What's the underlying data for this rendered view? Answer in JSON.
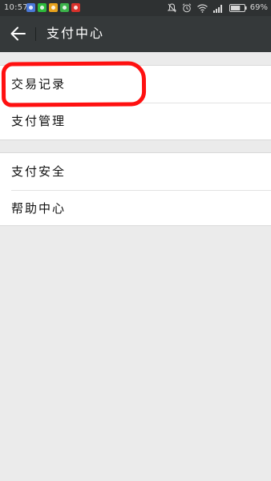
{
  "status_bar": {
    "time": "10:57",
    "battery": "69%",
    "notification_icons": [
      "app-notification-icon",
      "wechat-icon",
      "weibo-icon",
      "wechat-icon",
      "netease-music-icon"
    ]
  },
  "app_bar": {
    "title": "支付中心"
  },
  "sections": [
    {
      "items": [
        {
          "label": "交易记录"
        },
        {
          "label": "支付管理"
        }
      ]
    },
    {
      "items": [
        {
          "label": "支付安全"
        },
        {
          "label": "帮助中心"
        }
      ]
    }
  ],
  "colors": {
    "app_bar": "#35393a",
    "status_bar": "#2e3132",
    "background": "#ebebeb",
    "highlight": "#ff1010"
  }
}
